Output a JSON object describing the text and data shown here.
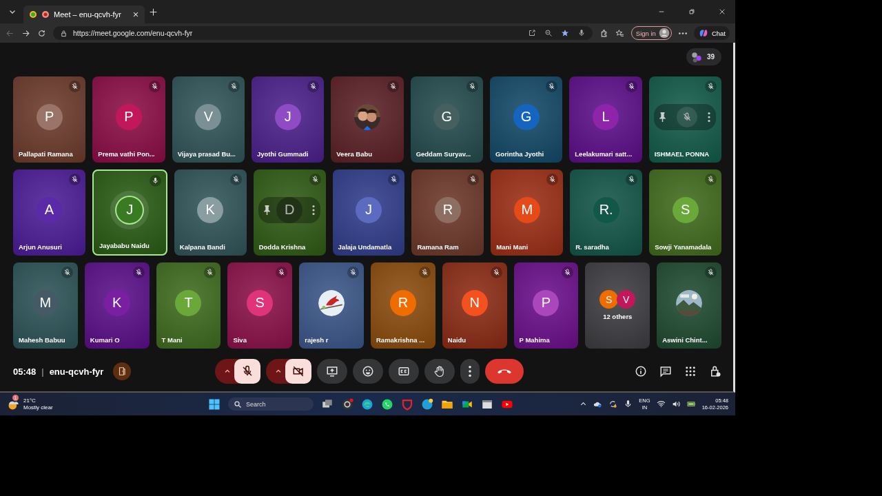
{
  "browser": {
    "tab_title": "Meet – enu-qcvh-fyr",
    "url": "https://meet.google.com/enu-qcvh-fyr",
    "sign_in": "Sign in",
    "chat": "Chat"
  },
  "participant_count": "39",
  "tile_rows": [
    [
      {
        "name": "Pallapati Ramana",
        "avatar": {
          "initial": "P",
          "color": "#9a7468"
        },
        "kind": "letter",
        "color": "#6b3a2a",
        "muted": true,
        "speaking": false,
        "hovered": false
      },
      {
        "name": "Prema vathi Pon...",
        "avatar": {
          "initial": "P",
          "color": "#c2185b"
        },
        "kind": "letter",
        "color": "#8a0c45",
        "muted": true,
        "speaking": false,
        "hovered": false
      },
      {
        "name": "Vijaya prasad Bu...",
        "avatar": {
          "initial": "V",
          "color": "#7a9095"
        },
        "kind": "letter",
        "color": "#2f5358",
        "muted": true,
        "speaking": false,
        "hovered": false
      },
      {
        "name": "Jyothi Gummadi",
        "avatar": {
          "initial": "J",
          "color": "#8e4bc4"
        },
        "kind": "letter",
        "color": "#4a1f8a",
        "muted": true,
        "speaking": false,
        "hovered": false
      },
      {
        "name": "Veera Babu",
        "kind": "picture",
        "color": "#5a1f25",
        "muted": true,
        "speaking": false,
        "hovered": false
      },
      {
        "name": "Geddam Suryav...",
        "avatar": {
          "initial": "G",
          "color": "#45605f"
        },
        "kind": "letter",
        "color": "#234a4c",
        "muted": true,
        "speaking": false,
        "hovered": false
      },
      {
        "name": "Gorintha Jyothi",
        "avatar": {
          "initial": "G",
          "color": "#1565c0"
        },
        "kind": "letter",
        "color": "#124866",
        "muted": true,
        "speaking": false,
        "hovered": false
      },
      {
        "name": "Leelakumari satt...",
        "avatar": {
          "initial": "L",
          "color": "#8e24aa"
        },
        "kind": "letter",
        "color": "#5b0d88",
        "muted": true,
        "speaking": false,
        "hovered": false
      },
      {
        "name": "ISHMAEL PONNA",
        "kind": "blank",
        "color": "#115a48",
        "muted": true,
        "speaking": false,
        "hovered": true
      }
    ],
    [
      {
        "name": "Arjun Anusuri",
        "avatar": {
          "initial": "A",
          "color": "#5a2aa8"
        },
        "kind": "letter",
        "color": "#4b1b96",
        "muted": true,
        "speaking": false,
        "hovered": false
      },
      {
        "name": "Jayababu Naidu",
        "avatar": {
          "initial": "J",
          "color": "#3a7a22"
        },
        "kind": "letter",
        "color": "#285c14",
        "muted": false,
        "speaking": true,
        "hovered": false
      },
      {
        "name": "Kalpana Bandi",
        "avatar": {
          "initial": "K",
          "color": "#8a9da0"
        },
        "kind": "letter",
        "color": "#2f5358",
        "muted": true,
        "speaking": false,
        "hovered": false
      },
      {
        "name": "Dodda Krishna",
        "avatar": {
          "initial": "D",
          "color": "#2f4a22"
        },
        "kind": "letter",
        "color": "#2e5a14",
        "muted": true,
        "speaking": false,
        "hovered": true
      },
      {
        "name": "Jalaja Undamatla",
        "avatar": {
          "initial": "J",
          "color": "#5c6bc0"
        },
        "kind": "letter",
        "color": "#2f3c8a",
        "muted": true,
        "speaking": false,
        "hovered": false
      },
      {
        "name": "Ramana Ram",
        "avatar": {
          "initial": "R",
          "color": "#8d6e63"
        },
        "kind": "letter",
        "color": "#6b3628",
        "muted": true,
        "speaking": false,
        "hovered": false
      },
      {
        "name": "Mani Mani",
        "avatar": {
          "initial": "M",
          "color": "#e64a19"
        },
        "kind": "letter",
        "color": "#9a2d14",
        "muted": true,
        "speaking": false,
        "hovered": false
      },
      {
        "name": "R. saradha",
        "avatar": {
          "initial": "R.",
          "color": "#11584a"
        },
        "kind": "letter",
        "color": "#125446",
        "muted": true,
        "speaking": false,
        "hovered": false
      },
      {
        "name": "Sowji Yanamadala",
        "avatar": {
          "initial": "S",
          "color": "#6aa83a"
        },
        "kind": "letter",
        "color": "#3f6a1c",
        "muted": true,
        "speaking": false,
        "hovered": false
      }
    ],
    [
      {
        "name": "Mahesh Babuu",
        "avatar": {
          "initial": "M",
          "color": "#455a64"
        },
        "kind": "letter",
        "color": "#2b5256",
        "muted": true,
        "speaking": false,
        "hovered": false
      },
      {
        "name": "Kumari O",
        "avatar": {
          "initial": "K",
          "color": "#7b1fa2"
        },
        "kind": "letter",
        "color": "#5a0e88",
        "muted": true,
        "speaking": false,
        "hovered": false
      },
      {
        "name": "T Mani",
        "avatar": {
          "initial": "T",
          "color": "#6aa83a"
        },
        "kind": "letter",
        "color": "#3e6a1e",
        "muted": true,
        "speaking": false,
        "hovered": false
      },
      {
        "name": "Siva",
        "avatar": {
          "initial": "S",
          "color": "#e0337a"
        },
        "kind": "letter",
        "color": "#8a1048",
        "muted": true,
        "speaking": false,
        "hovered": false
      },
      {
        "name": "rajesh r",
        "kind": "bird",
        "color": "#3a5588",
        "muted": true,
        "speaking": false,
        "hovered": false
      },
      {
        "name": "Ramakrishna ...",
        "avatar": {
          "initial": "R",
          "color": "#ef6c00"
        },
        "kind": "letter",
        "color": "#8a4a0c",
        "muted": true,
        "speaking": false,
        "hovered": false
      },
      {
        "name": "Naidu",
        "avatar": {
          "initial": "N",
          "color": "#f4511e"
        },
        "kind": "letter",
        "color": "#8a2a14",
        "muted": true,
        "speaking": false,
        "hovered": false
      },
      {
        "name": "P Mahima",
        "avatar": {
          "initial": "P",
          "color": "#ab47bc"
        },
        "kind": "letter",
        "color": "#6a0e8a",
        "muted": true,
        "speaking": false,
        "hovered": false
      },
      {
        "kind": "others",
        "color": "#3c3c40",
        "label": "12 others",
        "avatars": [
          {
            "initial": "S",
            "color": "#ef6c00"
          },
          {
            "initial": "V",
            "color": "#c2185b"
          }
        ]
      },
      {
        "name": "Aswini Chint...",
        "kind": "landscape",
        "color": "#1e4a30",
        "muted": true,
        "speaking": false,
        "hovered": false
      }
    ]
  ],
  "meeting": {
    "time": "05:48",
    "separator": "|",
    "code": "enu-qcvh-fyr"
  },
  "controls": {
    "mic_on": false,
    "camera_on": false
  },
  "taskbar": {
    "temperature": "21°C",
    "weather": "Mostly clear",
    "weather_badge": "1",
    "search": "Search",
    "language": "ENG",
    "region": "IN",
    "time": "05:48",
    "date": "16-02-2026"
  }
}
